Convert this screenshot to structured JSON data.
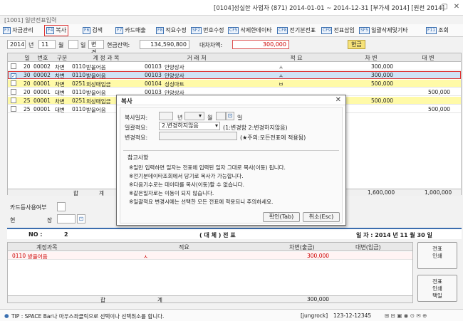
{
  "window": {
    "title": "[0104]성실한 사업자  (871)  2014-01-01 ~ 2014-12-31 [부가세 2014] [원천 2014]",
    "subtitle": "[1001] 일반전표입력"
  },
  "toolbar": {
    "items": [
      {
        "key": "F3",
        "label": "자금관리"
      },
      {
        "key": "F4",
        "label": "복사"
      },
      {
        "key": "F6",
        "label": "검색"
      },
      {
        "key": "F7",
        "label": "카드매출"
      },
      {
        "key": "F8",
        "label": "적요수정"
      },
      {
        "key": "SF2",
        "label": "번호수정"
      },
      {
        "key": "CF5",
        "label": "삭제한데이타"
      },
      {
        "key": "CF8",
        "label": "전기분전표"
      },
      {
        "key": "CF9",
        "label": "전표삽입"
      },
      {
        "key": "SF5",
        "label": "일괄삭제및기타"
      },
      {
        "key": "F11",
        "label": "조회"
      }
    ],
    "search_placeholder": "vvip검색"
  },
  "filter": {
    "year": "2014",
    "month": "11",
    "month_label": "월",
    "day_label": "일",
    "change_label": "변경",
    "cash_balance_label": "현금잔액:",
    "cash_balance": "134,590,800",
    "diff_label": "대차차액:",
    "diff": "300,000",
    "cash_button": "현금"
  },
  "grid": {
    "columns": [
      "일",
      "번호",
      "구분",
      "계 정 과 목",
      "거 래 처",
      "적 요",
      "차 변",
      "대 변"
    ],
    "rows": [
      {
        "checked": false,
        "day": "20",
        "no": "00002",
        "type": "차변",
        "code": "0110",
        "account": "받을어음",
        "cust_code": "00103",
        "customer": "안양상사",
        "memo": "ㅅ",
        "debit": "300,000",
        "credit": "",
        "style": "normal"
      },
      {
        "checked": true,
        "day": "30",
        "no": "00002",
        "type": "차변",
        "code": "0110",
        "account": "받을어음",
        "cust_code": "00103",
        "customer": "안양상사",
        "memo": "ㅅ",
        "debit": "300,000",
        "credit": "",
        "style": "selected"
      },
      {
        "checked": false,
        "day": "20",
        "no": "00001",
        "type": "차변",
        "code": "0251",
        "account": "외상매입금",
        "cust_code": "00104",
        "customer": "싱싱마트",
        "memo": "ㅂ",
        "debit": "500,000",
        "credit": "",
        "style": "yellow"
      },
      {
        "checked": false,
        "day": "20",
        "no": "00001",
        "type": "대변",
        "code": "0110",
        "account": "받을어음",
        "cust_code": "00103",
        "customer": "안양상사",
        "memo": "",
        "debit": "",
        "credit": "500,000",
        "style": "normal"
      },
      {
        "checked": false,
        "day": "25",
        "no": "00001",
        "type": "차변",
        "code": "0251",
        "account": "외상매입금",
        "cust_code": "",
        "customer": "",
        "memo": "",
        "debit": "500,000",
        "credit": "",
        "style": "yellow"
      },
      {
        "checked": false,
        "day": "25",
        "no": "00001",
        "type": "대변",
        "code": "0110",
        "account": "받을어음",
        "cust_code": "",
        "customer": "",
        "memo": "",
        "debit": "",
        "credit": "500,000",
        "style": "normal"
      }
    ],
    "total_label_a": "합",
    "total_label_b": "계",
    "total_debit": "1,600,000",
    "total_credit": "1,000,000"
  },
  "lower": {
    "card_label": "카드등사용여부",
    "hyun": "현",
    "jang": "장"
  },
  "banner": {
    "no_label": "NO :",
    "no_value": "2",
    "type": "( 대 체 )  전  표",
    "date": "일 자 : 2014 년 11 월 30 일"
  },
  "grid2": {
    "columns": [
      "계정과목",
      "적요",
      "차변(출금)",
      "대변(입금)"
    ],
    "rows": [
      {
        "code": "0110",
        "account": "받을어음",
        "memo": "ㅅ",
        "debit": "300,000",
        "credit": ""
      }
    ],
    "total_a": "합",
    "total_b": "계",
    "total_debit": "300,000"
  },
  "side_buttons": {
    "print_slip": "전표\n인쇄",
    "print_tag": "전표\n인쇄\n택일"
  },
  "status": {
    "tip": "TIP : SPACE Bar나 마우스좌클릭으로 선택이나 선택취소를 합니다.",
    "user": "[jungrock]",
    "code": "123-12-12345"
  },
  "dialog": {
    "title": "복사",
    "copy_date_label": "복사일자:",
    "year_suffix": "년",
    "month_suffix": "월",
    "day_suffix": "일",
    "batch_memo_label": "일괄적요:",
    "batch_memo_value": "2.변경하지않음",
    "batch_memo_hint": "(1:변경함 2:변경하지않음)",
    "change_memo_label": "변경적요:",
    "change_memo_hint": "(★주의:모든전표에 적용됨)",
    "notes_title": "참고사항",
    "notes": [
      "※일만 입력하면 일자는 전표에 입력된 일자 그대로 복사(이동) 됩니다.",
      "※전기분데이타조회에서 당기로 복사가 가능합니다.",
      "※다음기수로는 데이타를 복사(이동)할 수 없습니다.",
      "※같은일자로는 이동이 되지 않습니다.",
      "※일괄적요 변경시에는 선택한 모든 전표에 적용되니 주의하세요."
    ],
    "ok_button": "확인(Tab)",
    "cancel_button": "취소(Esc)"
  }
}
